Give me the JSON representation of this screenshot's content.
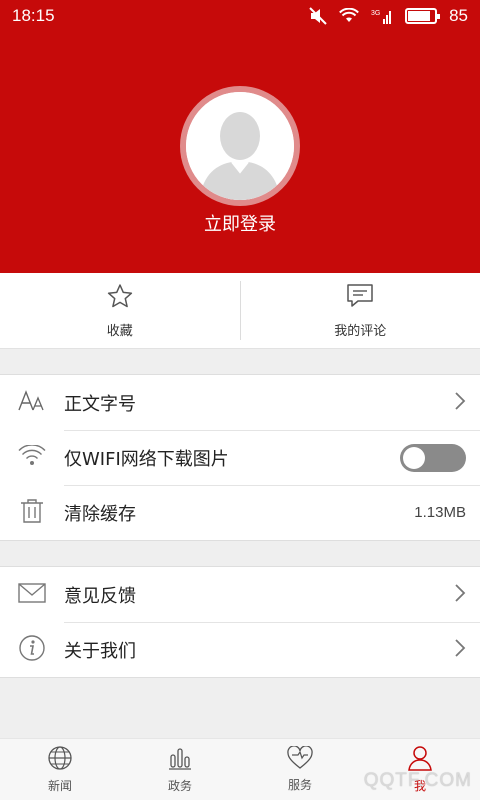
{
  "status_bar": {
    "time": "18:15",
    "battery": "85",
    "battery_level": 0.85,
    "network": "3G"
  },
  "header": {
    "login_label": "立即登录",
    "color": "#c60a0a"
  },
  "quick_actions": [
    {
      "label": "收藏",
      "icon": "star-icon"
    },
    {
      "label": "我的评论",
      "icon": "comment-icon"
    }
  ],
  "settings": {
    "font_size_label": "正文字号",
    "wifi_only_label": "仅WIFI网络下载图片",
    "wifi_only_enabled": false,
    "clear_cache_label": "清除缓存",
    "cache_size": "1.13MB",
    "feedback_label": "意见反馈",
    "about_label": "关于我们"
  },
  "tabs": [
    {
      "label": "新闻",
      "icon": "globe-icon",
      "active": false
    },
    {
      "label": "政务",
      "icon": "bar-chart-icon",
      "active": false
    },
    {
      "label": "服务",
      "icon": "heart-icon",
      "active": false
    },
    {
      "label": "我",
      "icon": "person-icon",
      "active": true
    }
  ],
  "watermark": "QQTF.COM"
}
